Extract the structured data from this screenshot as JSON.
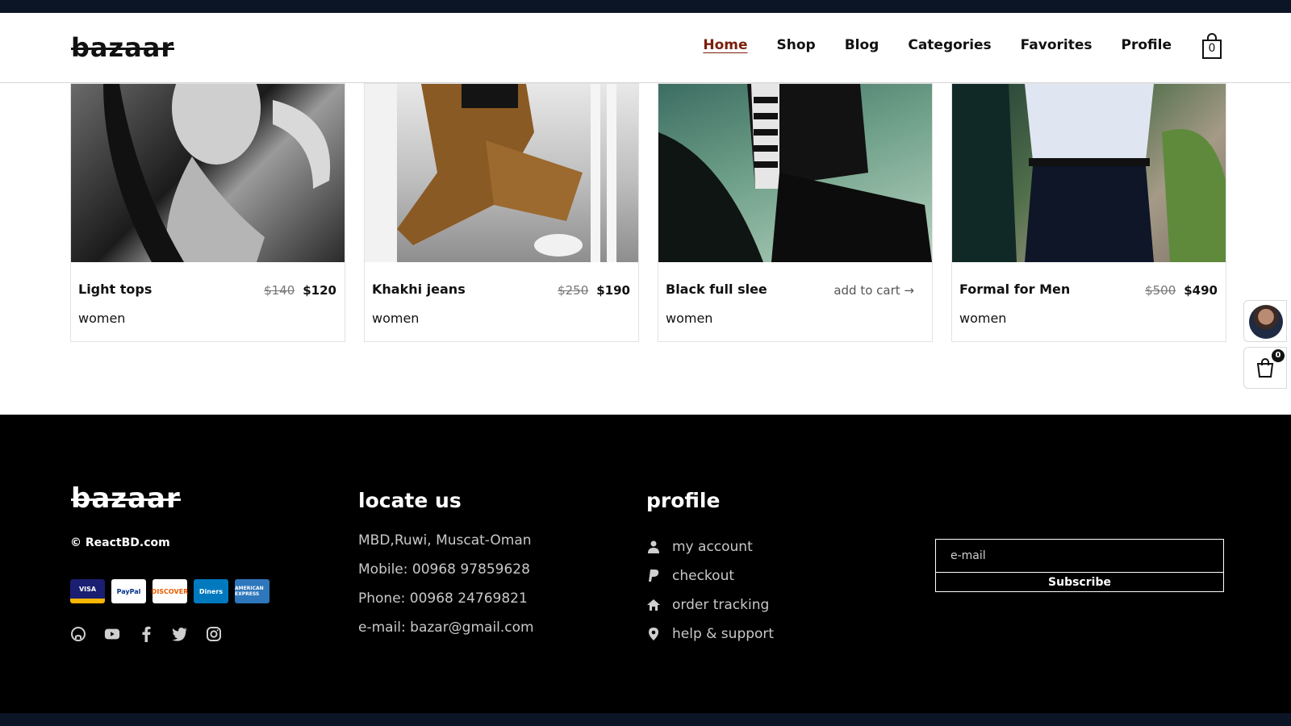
{
  "header": {
    "logo": "bazaar",
    "nav": [
      "Home",
      "Shop",
      "Blog",
      "Categories",
      "Favorites",
      "Profile"
    ],
    "active_nav": "Home",
    "cart_count": "0"
  },
  "products": [
    {
      "name": "Light tops",
      "category": "women",
      "old_price": "$140",
      "price": "$120"
    },
    {
      "name": "Khakhi jeans",
      "category": "women",
      "old_price": "$250",
      "price": "$190"
    },
    {
      "name": "Black full slee",
      "category": "women",
      "add_to_cart": "add to cart →"
    },
    {
      "name": "Formal for Men",
      "category": "women",
      "old_price": "$500",
      "price": "$490"
    }
  ],
  "side_cart": {
    "count": "0"
  },
  "footer": {
    "logo": "bazaar",
    "copyright": "© ReactBD.com",
    "payment_methods": [
      "VISA",
      "PayPal",
      "DISCOVER",
      "Diners",
      "AMERICAN EXPRESS"
    ],
    "social": [
      "github-icon",
      "youtube-icon",
      "facebook-icon",
      "twitter-icon",
      "instagram-icon"
    ],
    "locate": {
      "title": "locate us",
      "address": "MBD,Ruwi, Muscat-Oman",
      "mobile": "Mobile: 00968 97859628",
      "phone": "Phone: 00968 24769821",
      "email": "e-mail: bazar@gmail.com"
    },
    "profile": {
      "title": "profile",
      "links": [
        "my account",
        "checkout",
        "order tracking",
        "help & support"
      ]
    },
    "subscribe": {
      "placeholder": "e-mail",
      "button": "Subscribe"
    }
  },
  "colors": {
    "top_strip": "#0b1526",
    "active_link": "#7a1f0a",
    "footer_bg": "#000000"
  }
}
